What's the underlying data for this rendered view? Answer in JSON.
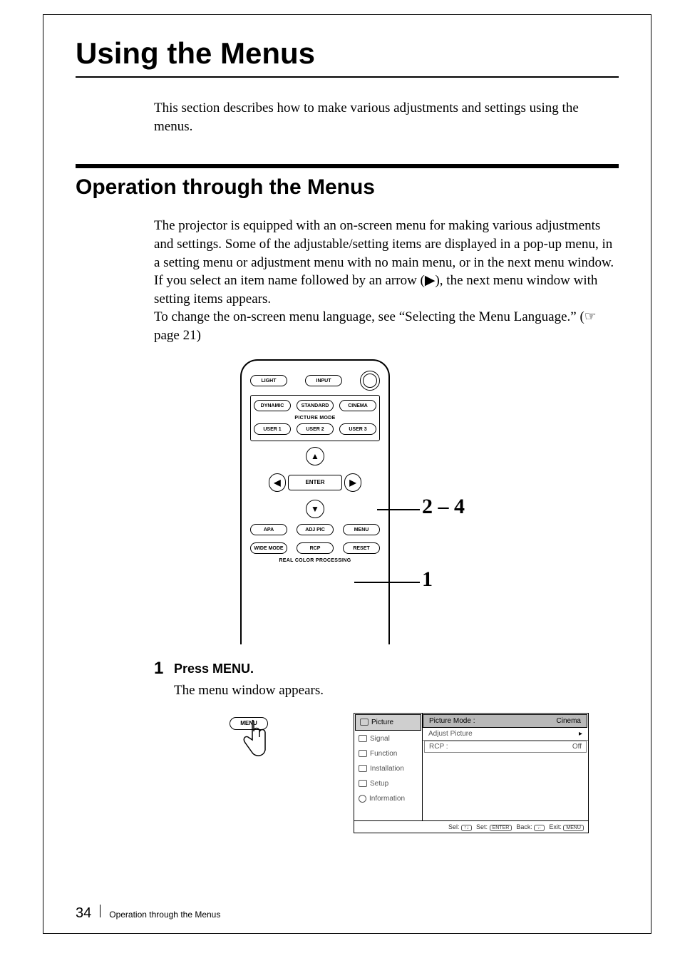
{
  "title": "Using the Menus",
  "intro": "This section describes how to make various adjustments and settings using the menus.",
  "section_title": "Operation through the Menus",
  "body": "The projector is equipped with an on-screen menu for making various adjustments and settings. Some of the adjustable/setting items are displayed in a pop-up menu, in a setting menu or adjustment menu with no main menu, or in the next menu window.  If you select an item name followed by an arrow (▶), the next menu window with setting items appears.\nTo change the  on-screen menu language, see “Selecting the Menu Language.” (☞ page 21)",
  "remote": {
    "row1": {
      "light": "LIGHT",
      "input": "INPUT",
      "power_symbol": "⏻"
    },
    "picture_mode_label": "PICTURE MODE",
    "row2": {
      "dynamic": "DYNAMIC",
      "standard": "STANDARD",
      "cinema": "CINEMA"
    },
    "row3": {
      "user1": "USER 1",
      "user2": "USER 2",
      "user3": "USER 3"
    },
    "enter": "ENTER",
    "row4": {
      "apa": "APA",
      "adjpic": "ADJ PIC",
      "menu": "MENU"
    },
    "row5": {
      "wide": "WIDE MODE",
      "rcp": "RCP",
      "reset": "RESET"
    },
    "rcp_label": "REAL COLOR PROCESSING"
  },
  "callouts": {
    "steps_2_4": "2 – 4",
    "step_1": "1"
  },
  "step1": {
    "num": "1",
    "head": "Press MENU.",
    "body": "The menu window appears."
  },
  "menu_btn_label": "MENU",
  "osd": {
    "tabs": {
      "picture": "Picture",
      "signal": "Signal",
      "function": "Function",
      "installation": "Installation",
      "setup": "Setup",
      "information": "Information"
    },
    "fields": {
      "picture_mode_label": "Picture Mode :",
      "picture_mode_value": "Cinema",
      "adjust_picture": "Adjust Picture",
      "rcp_label": "RCP :",
      "rcp_value": "Off"
    },
    "footer": {
      "sel": "Sel:",
      "set": "Set:",
      "back": "Back:",
      "exit": "Exit:",
      "enter_key": "ENTER",
      "menu_key": "MENU"
    }
  },
  "footer": {
    "page": "34",
    "text": "Operation through the Menus"
  }
}
